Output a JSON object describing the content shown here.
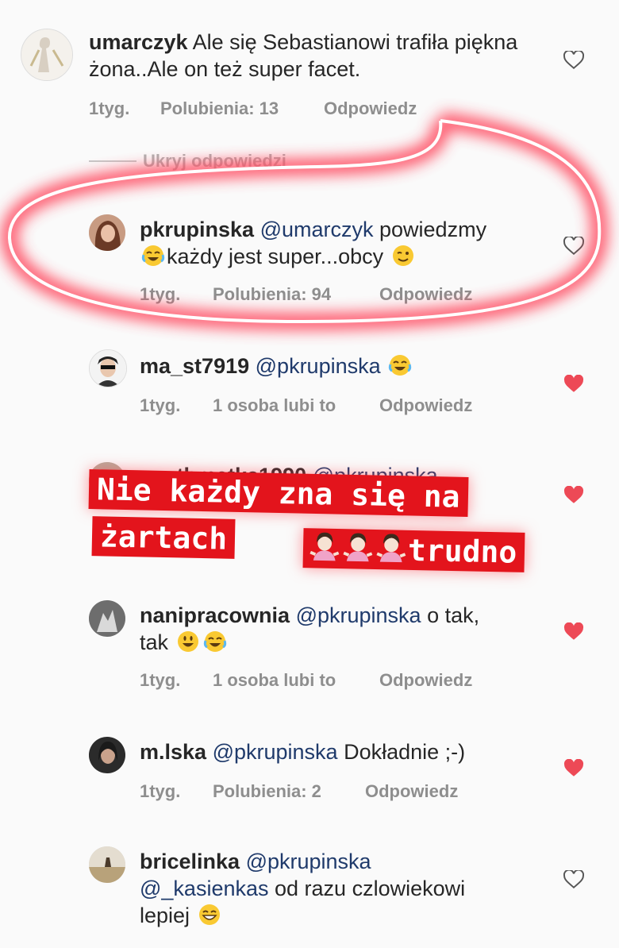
{
  "comments": [
    {
      "username": "umarczyk",
      "mention": "",
      "text": "Ale się Sebastianowi trafiła piękna żona..Ale on też super facet.",
      "time": "1tyg.",
      "likes": "Polubienia: 13",
      "reply": "Odpowiedz",
      "liked": false
    },
    {
      "username": "pkrupinska",
      "mention": "@umarczyk",
      "text_part1": "powiedzmy",
      "text_part2": "każdy jest super...obcy",
      "time": "1tyg.",
      "likes": "Polubienia: 94",
      "reply": "Odpowiedz",
      "liked": false
    },
    {
      "username": "ma_st7919",
      "mention": "@pkrupinska",
      "text": "",
      "time": "1tyg.",
      "likes": "1 osoba lubi to",
      "reply": "Odpowiedz",
      "liked": true
    },
    {
      "username": "anethmatka1990",
      "mention": "@pkrupinska",
      "text": "",
      "liked": true
    },
    {
      "username": "nanipracownia",
      "mention": "@pkrupinska",
      "text_part1": "o tak,",
      "text_part2": "tak",
      "time": "1tyg.",
      "likes": "1 osoba lubi to",
      "reply": "Odpowiedz",
      "liked": true
    },
    {
      "username": "m.lska",
      "mention": "@pkrupinska",
      "text": "Dokładnie ;-)",
      "time": "1tyg.",
      "likes": "Polubienia: 2",
      "reply": "Odpowiedz",
      "liked": true
    },
    {
      "username": "bricelinka",
      "mention": "@pkrupinska",
      "mention2": "@_kasienkas",
      "text_part1": "od razu czlowiekowi",
      "text_part2": "lepiej",
      "liked": false
    }
  ],
  "hide_replies": "Ukryj odpowiedzi",
  "overlay": {
    "line1_a": "Nie każdy zna się na",
    "line1_b": "żartach",
    "line2": "trudno"
  },
  "colors": {
    "heart_red": "#ed4956",
    "banner_red": "#e3141c",
    "mention": "#1f3a6b",
    "meta_gray": "#8e8e8e"
  }
}
